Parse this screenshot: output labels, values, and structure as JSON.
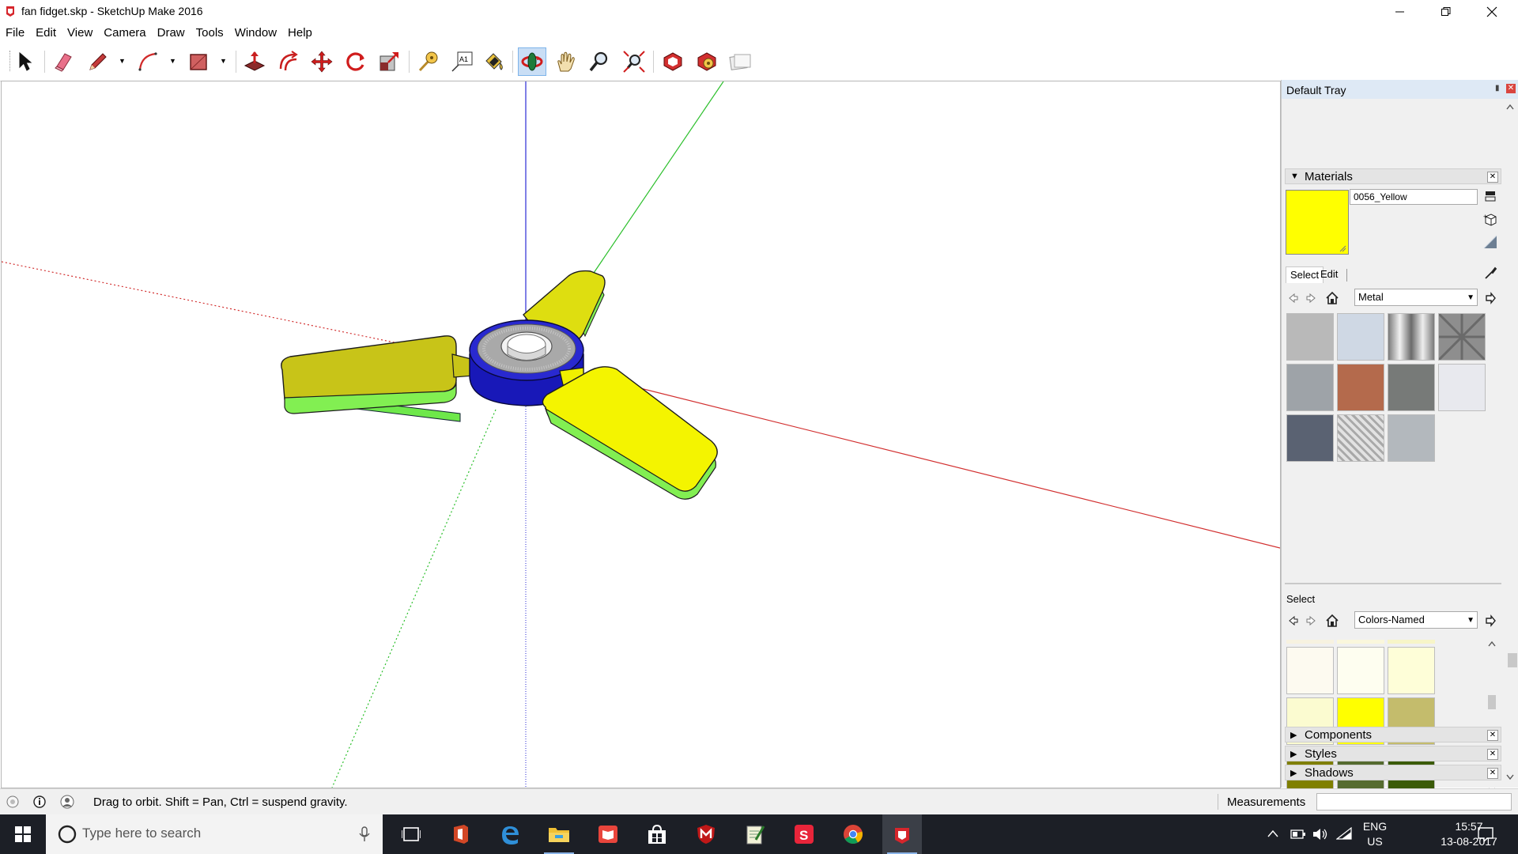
{
  "window": {
    "title": "fan fidget.skp - SketchUp Make 2016",
    "minimize": "—",
    "restore": "❐",
    "close": "✕"
  },
  "menu": [
    "File",
    "Edit",
    "View",
    "Camera",
    "Draw",
    "Tools",
    "Window",
    "Help"
  ],
  "toolbar": {
    "tools": [
      {
        "name": "select-tool",
        "icon": "arrow-cursor-icon"
      },
      {
        "name": "eraser-tool",
        "icon": "eraser-icon"
      },
      {
        "name": "line-tool",
        "icon": "pencil-icon"
      },
      {
        "name": "arc-tool",
        "icon": "arc-icon"
      },
      {
        "name": "rectangle-tool",
        "icon": "rectangle-icon"
      },
      {
        "name": "push-pull-tool",
        "icon": "push-pull-icon"
      },
      {
        "name": "offset-tool",
        "icon": "offset-icon"
      },
      {
        "name": "move-tool",
        "icon": "move-icon"
      },
      {
        "name": "rotate-tool",
        "icon": "rotate-icon"
      },
      {
        "name": "scale-tool",
        "icon": "scale-icon"
      },
      {
        "name": "tape-measure-tool",
        "icon": "tape-measure-icon"
      },
      {
        "name": "text-tool",
        "icon": "text-icon"
      },
      {
        "name": "paint-bucket-tool",
        "icon": "paint-bucket-icon"
      },
      {
        "name": "orbit-tool",
        "icon": "orbit-icon",
        "active": true
      },
      {
        "name": "pan-tool",
        "icon": "hand-icon"
      },
      {
        "name": "zoom-tool",
        "icon": "zoom-icon"
      },
      {
        "name": "zoom-extents-tool",
        "icon": "zoom-extents-icon"
      },
      {
        "name": "warehouse-tool",
        "icon": "3d-warehouse-icon"
      },
      {
        "name": "extension-warehouse-tool",
        "icon": "extension-warehouse-icon"
      },
      {
        "name": "layout-tool",
        "icon": "send-to-layout-icon"
      }
    ]
  },
  "tray": {
    "title": "Default Tray",
    "materials": {
      "header": "Materials",
      "current_name": "0056_Yellow",
      "current_color": "#ffff00",
      "tabs": [
        "Select",
        "Edit"
      ],
      "library": "Metal",
      "swatches": [
        "#b9b9b9",
        "#cfd8e4",
        "#d9d9d9",
        "#8e8e8e",
        "#9ea3a8",
        "#b46a4c",
        "#777a78",
        "#e8e9ee",
        "#5a6272",
        "#cfcfcf",
        "#b3b8bd"
      ],
      "secondary_label": "Select",
      "secondary_library": "Colors-Named",
      "color_swatches": [
        "#fdfaf0",
        "#fefef0",
        "#fefed8",
        "#fbfbd0",
        "#ffff00",
        "#c4bc6c",
        "#7f7f00",
        "#556b2f",
        "#3b5b08"
      ]
    },
    "collapsed_panels": [
      "Components",
      "Styles",
      "Shadows"
    ]
  },
  "status": {
    "hint": "Drag to orbit. Shift = Pan, Ctrl = suspend gravity.",
    "measurements_label": "Measurements",
    "measurements_value": ""
  },
  "taskbar": {
    "search_placeholder": "Type here to search",
    "apps": [
      "task-view",
      "office",
      "edge",
      "file-explorer",
      "reader",
      "store",
      "mcafee",
      "notepad",
      "sketchbook",
      "chrome",
      "sketchup"
    ],
    "lang": "ENG",
    "region": "US",
    "time": "15:57",
    "date": "13-08-2017"
  }
}
